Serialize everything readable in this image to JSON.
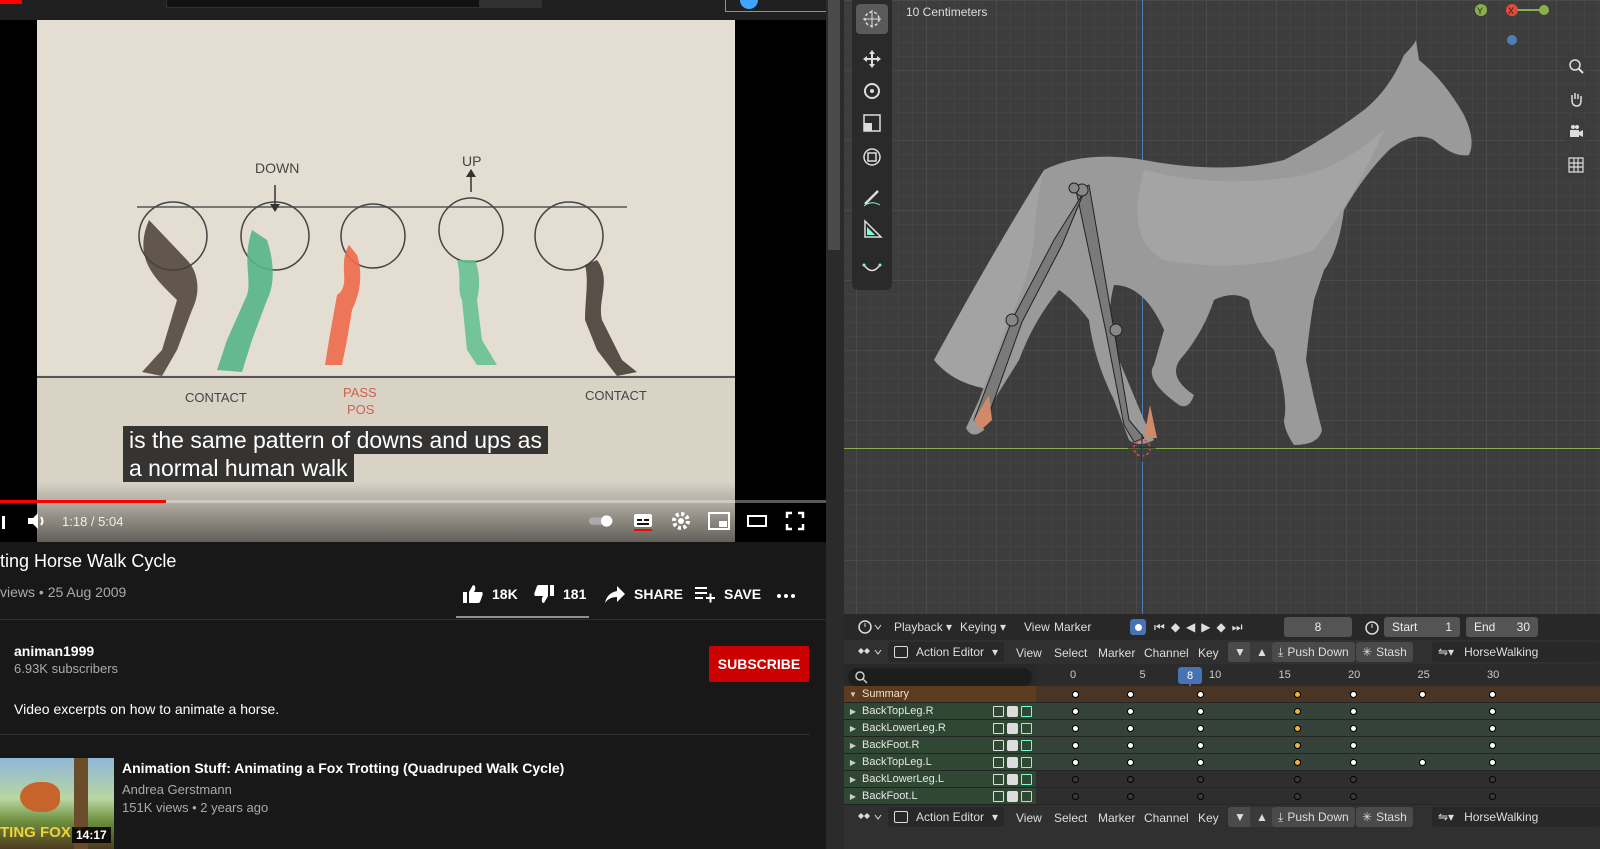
{
  "youtube": {
    "caption_line1": "is the same pattern of downs and ups as",
    "caption_line2": "a normal human walk",
    "time": "1:18 / 5:04",
    "progress_fraction": 0.2,
    "title": "ting Horse Walk Cycle",
    "views": "views • 25 Aug 2009",
    "likes": "18K",
    "dislikes": "181",
    "share": "SHARE",
    "save": "SAVE",
    "channel_name": "animan1999",
    "subscribers": "6.93K subscribers",
    "subscribe": "SUBSCRIBE",
    "description": "Video excerpts on how to animate a horse.",
    "frame_text": {
      "down": "DOWN",
      "up": "UP",
      "contact1": "CONTACT",
      "pass": "PASS",
      "pos": "POS",
      "contact2": "CONTACT"
    },
    "recommended": {
      "title": "Animation Stuff: Animating a Fox Trotting (Quadruped Walk Cycle)",
      "channel": "Andrea Gerstmann",
      "meta": "151K views • 2 years ago",
      "duration": "14:17",
      "thumb_text": "TING FOX T"
    }
  },
  "blender": {
    "units": "10 Centimeters",
    "timeline": {
      "playback": "Playback",
      "keying": "Keying",
      "view": "View",
      "marker": "Marker",
      "current_frame": "8",
      "start_label": "Start",
      "start": "1",
      "end_label": "End",
      "end": "30"
    },
    "action_editor": {
      "mode": "Action Editor",
      "menus": [
        "View",
        "Select",
        "Marker",
        "Channel",
        "Key"
      ],
      "push_down": "Push Down",
      "stash": "Stash",
      "action_name": "HorseWalking",
      "ruler": [
        "0",
        "5",
        "10",
        "15",
        "20",
        "25",
        "30"
      ],
      "current_frame": "8",
      "channels": [
        {
          "name": "Summary"
        },
        {
          "name": "BackTopLeg.R"
        },
        {
          "name": "BackLowerLeg.R"
        },
        {
          "name": "BackFoot.R"
        },
        {
          "name": "BackTopLeg.L"
        },
        {
          "name": "BackLowerLeg.L"
        },
        {
          "name": "BackFoot.L"
        }
      ]
    },
    "colors": {
      "summary_row": "#5c3b1e",
      "channel_row": "#2f4733",
      "key_white": "#ffffff",
      "key_selected": "#f0b43c",
      "current_frame": "#4772b3"
    }
  }
}
